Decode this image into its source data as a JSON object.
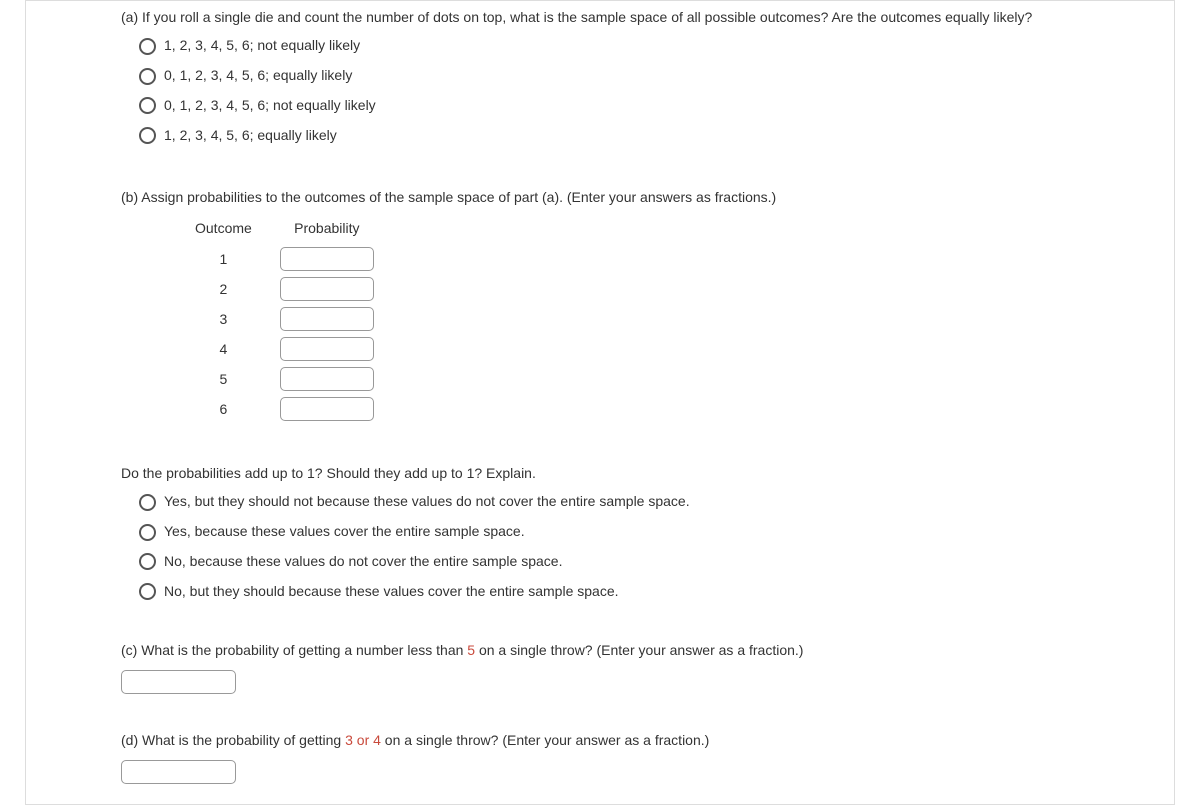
{
  "partA": {
    "prompt": "(a) If you roll a single die and count the number of dots on top, what is the sample space of all possible outcomes? Are the outcomes equally likely?",
    "options": [
      "1, 2, 3, 4, 5, 6; not equally likely",
      "0, 1, 2, 3, 4, 5, 6; equally likely",
      "0, 1, 2, 3, 4, 5, 6; not equally likely",
      "1, 2, 3, 4, 5, 6; equally likely"
    ]
  },
  "partB": {
    "prompt": "(b) Assign probabilities to the outcomes of the sample space of part (a). (Enter your answers as fractions.)",
    "headers": {
      "outcome": "Outcome",
      "probability": "Probability"
    },
    "rows": [
      {
        "outcome": "1"
      },
      {
        "outcome": "2"
      },
      {
        "outcome": "3"
      },
      {
        "outcome": "4"
      },
      {
        "outcome": "5"
      },
      {
        "outcome": "6"
      }
    ],
    "followup": "Do the probabilities add up to 1? Should they add up to 1? Explain.",
    "followupOptions": [
      "Yes, but they should not because these values do not cover the entire sample space.",
      "Yes, because these values cover the entire sample space.",
      "No, because these values do not cover the entire sample space.",
      "No, but they should because these values cover the entire sample space."
    ]
  },
  "partC": {
    "prefix": "(c) What is the probability of getting a number less than ",
    "highlight": "5",
    "suffix": " on a single throw? (Enter your answer as a fraction.)"
  },
  "partD": {
    "prefix": "(d) What is the probability of getting ",
    "highlight": "3 or 4",
    "suffix": " on a single throw? (Enter your answer as a fraction.)"
  }
}
